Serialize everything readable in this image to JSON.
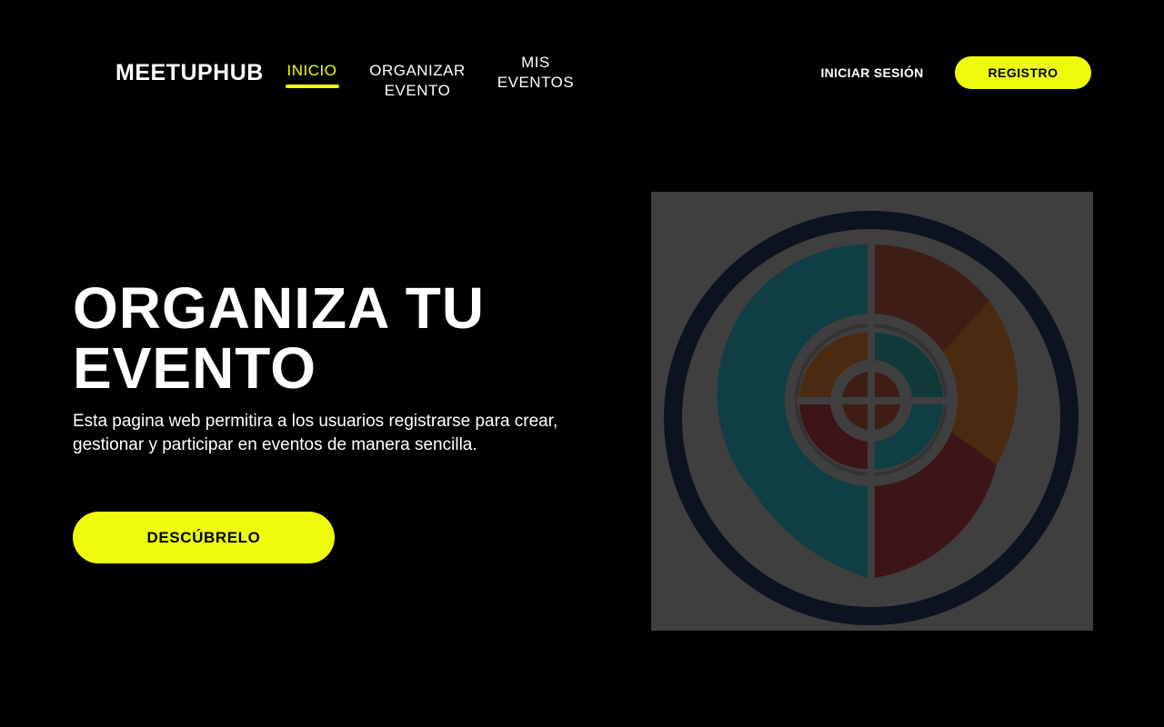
{
  "header": {
    "logo": "MEETUPHUB",
    "nav": {
      "inicio": "INICIO",
      "organizar_line1": "ORGANIZAR",
      "organizar_line2": "EVENTO",
      "mis_line1": "MIS",
      "mis_line2": "EVENTOS"
    },
    "login_label": "INICIAR SESIÓN",
    "register_label": "REGISTRO"
  },
  "hero": {
    "title_line1": "ORGANIZA TU",
    "title_line2": "EVENTO",
    "description": "Esta pagina web permitira a los usuarios registrarse para crear, gestionar y participar en eventos de manera sencilla.",
    "cta_label": "DESCÚBRELO"
  },
  "colors": {
    "background": "#000000",
    "accent": "#eefc0c",
    "text": "#ffffff",
    "image_overlay": "#3f3f3f"
  },
  "hero_image": {
    "icon": "event-logo-icon"
  }
}
